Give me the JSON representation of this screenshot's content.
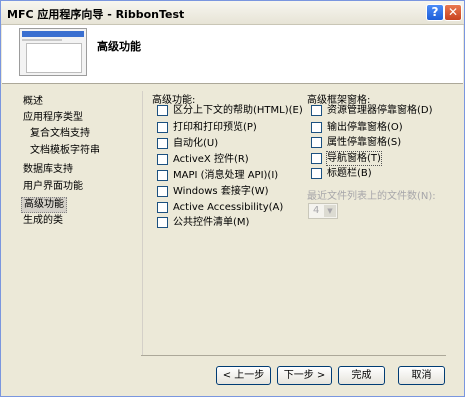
{
  "window": {
    "title": "MFC 应用程序向导 - RibbonTest",
    "help_glyph": "?",
    "close_glyph": "✕"
  },
  "header": {
    "title": "高级功能"
  },
  "nav": {
    "items": [
      {
        "label": "概述"
      },
      {
        "label": "应用程序类型"
      },
      {
        "label": "复合文档支持"
      },
      {
        "label": "文档模板字符串"
      },
      {
        "label": "数据库支持"
      },
      {
        "label": "用户界面功能"
      },
      {
        "label": "高级功能"
      },
      {
        "label": "生成的类"
      }
    ]
  },
  "advanced": {
    "title": "高级功能:",
    "options": [
      {
        "label": "区分上下文的帮助(HTML)(E)",
        "checked": false
      },
      {
        "label": "打印和打印预览(P)",
        "checked": false
      },
      {
        "label": "自动化(U)",
        "checked": false
      },
      {
        "label": "ActiveX 控件(R)",
        "checked": false
      },
      {
        "label": "MAPI (消息处理 API)(I)",
        "checked": false
      },
      {
        "label": "Windows 套接字(W)",
        "checked": false
      },
      {
        "label": "Active Accessibility(A)",
        "checked": false
      },
      {
        "label": "公共控件清单(M)",
        "checked": false
      }
    ]
  },
  "frame_panes": {
    "title": "高级框架窗格:",
    "options": [
      {
        "label": "资源管理器停靠窗格(D)",
        "checked": false
      },
      {
        "label": "输出停靠窗格(O)",
        "checked": false
      },
      {
        "label": "属性停靠窗格(S)",
        "checked": false
      },
      {
        "label": "导航窗格(T)",
        "checked": false
      },
      {
        "label": "标题栏(B)",
        "checked": false
      }
    ]
  },
  "mru": {
    "label": "最近文件列表上的文件数(N):",
    "value": "4"
  },
  "buttons": {
    "prev": "< 上一步",
    "next": "下一步 >",
    "finish": "完成",
    "cancel": "取消"
  }
}
